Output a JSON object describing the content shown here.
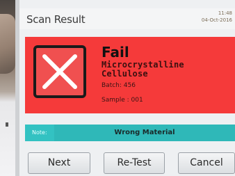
{
  "header": {
    "title": "Scan Result",
    "clock_time": "11:48",
    "clock_date": "04-Oct-2016"
  },
  "result": {
    "status": "Fail",
    "material_line1": "Microcrystalline",
    "material_line2": "Cellulose",
    "batch": "Batch: 456",
    "sample": "Sample : 001",
    "status_color": "#f53a3a"
  },
  "note": {
    "label": "Note:",
    "text": "Wrong Material",
    "color": "#2fb8b8"
  },
  "buttons": {
    "next": "Next",
    "retest": "Re-Test",
    "cancel": "Cancel"
  },
  "icons": {
    "fail": "x-mark-icon"
  }
}
